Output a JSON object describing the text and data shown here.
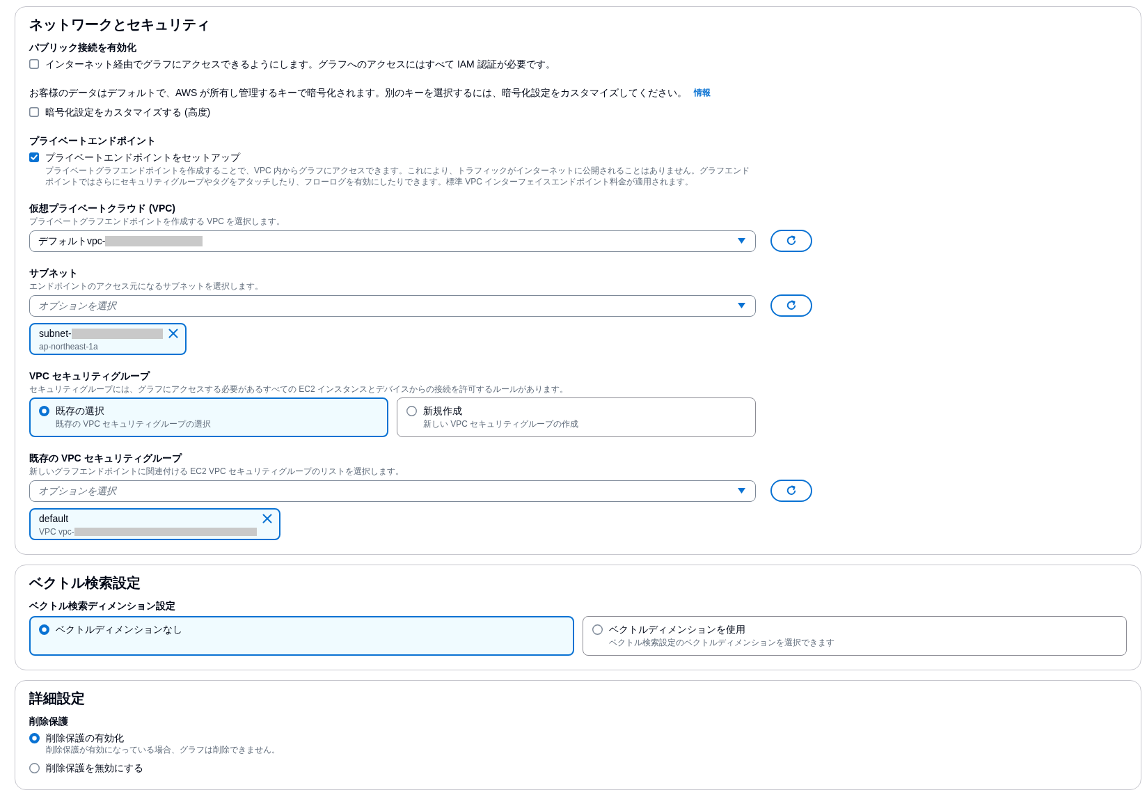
{
  "sections": [
    {
      "title": "ネットワークとセキュリティ",
      "fields": [
        {
          "kind": "checkbox",
          "label": "パブリック接続を有効化",
          "checkbox": {
            "text": "インターネット経由でグラフにアクセスできるようにします。グラフへのアクセスにはすべて IAM 認証が必要です。",
            "checked": false
          }
        },
        {
          "kind": "notice",
          "text": "お客様のデータはデフォルトで、AWS が所有し管理するキーで暗号化されます。別のキーを選択するには、暗号化設定をカスタマイズしてください。",
          "link": "情報",
          "checkbox": {
            "text": "暗号化設定をカスタマイズする (高度)",
            "checked": false
          }
        },
        {
          "kind": "checkbox",
          "label": "プライベートエンドポイント",
          "checkbox": {
            "text": "プライベートエンドポイントをセットアップ",
            "checked": true,
            "description": "プライベートグラフエンドポイントを作成することで、VPC 内からグラフにアクセスできます。これにより、トラフィックがインターネットに公開されることはありません。グラフエンドポイントではさらにセキュリティグループやタグをアタッチしたり、フローログを有効にしたりできます。標準 VPC インターフェイスエンドポイント料金が適用されます。"
          }
        },
        {
          "kind": "select",
          "label": "仮想プライベートクラウド (VPC)",
          "description": "プライベートグラフエンドポイントを作成する VPC を選択します。",
          "value": "デフォルトvpc-",
          "redacted": true,
          "refresh_button": true
        },
        {
          "kind": "select",
          "label": "サブネット",
          "description": "エンドポイントのアクセス元になるサブネットを選択します。",
          "placeholder": "オプションを選択",
          "redacted": false,
          "refresh_button": true,
          "tokens": [
            {
              "label": "subnet-",
              "label_redacted": true,
              "sublabel": "ap-northeast-1a",
              "sublabel_redacted": false
            }
          ]
        },
        {
          "kind": "tiles",
          "label": "VPC セキュリティグループ",
          "description": "セキュリティグループには、グラフにアクセスする必要があるすべての EC2 インスタンスとデバイスからの接続を許可するルールがあります。",
          "options": [
            {
              "label": "既存の選択",
              "description": "既存の VPC セキュリティグループの選択",
              "selected": true
            },
            {
              "label": "新規作成",
              "description": "新しい VPC セキュリティグループの作成",
              "selected": false
            }
          ]
        },
        {
          "kind": "select",
          "label": "既存の VPC セキュリティグループ",
          "description": "新しいグラフエンドポイントに関連付ける EC2 VPC セキュリティグループのリストを選択します。",
          "placeholder": "オプションを選択",
          "redacted": false,
          "refresh_button": true,
          "tokens": [
            {
              "label": "default",
              "label_redacted": false,
              "sublabel": "VPC vpc-",
              "sublabel_redacted": true
            }
          ]
        }
      ]
    },
    {
      "title": "ベクトル検索設定",
      "fields": [
        {
          "kind": "tiles",
          "label": "ベクトル検索ディメンション設定",
          "options": [
            {
              "label": "ベクトルディメンションなし",
              "selected": true
            },
            {
              "label": "ベクトルディメンションを使用",
              "description": "ベクトル検索設定のベクトルディメンションを選択できます",
              "selected": false
            }
          ]
        }
      ]
    },
    {
      "title": "詳細設定",
      "fields": [
        {
          "kind": "radios",
          "label": "削除保護",
          "options": [
            {
              "label": "削除保護の有効化",
              "description": "削除保護が有効になっている場合、グラフは削除できません。",
              "selected": true
            },
            {
              "label": "削除保護を無効にする",
              "selected": false
            }
          ]
        }
      ]
    }
  ]
}
